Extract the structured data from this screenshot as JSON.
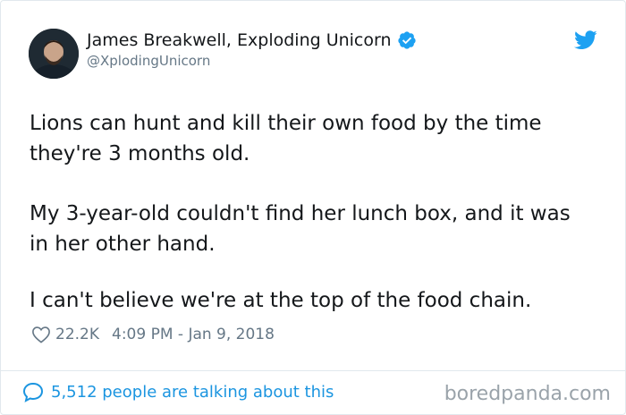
{
  "author": {
    "name": "James Breakwell, Exploding Unicorn",
    "handle": "@XplodingUnicorn",
    "verified": true
  },
  "tweet": {
    "lines": [
      "Lions can hunt and kill their own food by the time",
      "they're 3 months old.",
      "My 3-year-old couldn't find her lunch box, and it was",
      "in her other hand.",
      "I can't believe we're at the top of the food chain."
    ],
    "likes": "22.2K",
    "timestamp": "4:09 PM - Jan 9, 2018"
  },
  "footer": {
    "conversation": "5,512 people are talking about this"
  },
  "watermark": "boredpanda.com",
  "icons": {
    "heart": "heart-icon",
    "verified": "verified-badge-icon",
    "bird": "twitter-bird-icon",
    "bubble": "speech-bubble-icon"
  },
  "colors": {
    "accent": "#1b95e0",
    "text": "#14171a",
    "muted": "#657786"
  }
}
